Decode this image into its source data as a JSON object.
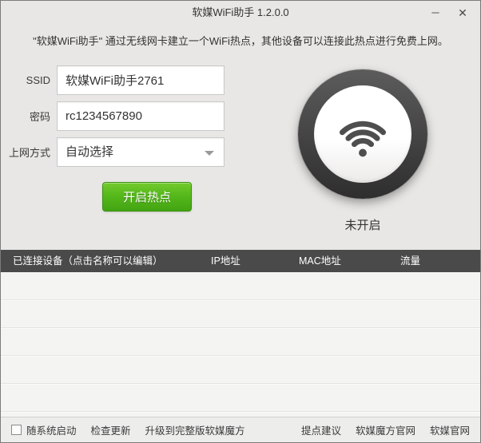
{
  "titlebar": {
    "title": "软媒WiFi助手 1.2.0.0",
    "minimize_glyph": "─",
    "close_glyph": "✕"
  },
  "intro": {
    "text": "\"软媒WiFi助手\" 通过无线网卡建立一个WiFi热点，其他设备可以连接此热点进行免费上网。"
  },
  "form": {
    "ssid_label": "SSID",
    "ssid_value": "软媒WiFi助手2761",
    "password_label": "密码",
    "password_value": "rc1234567890",
    "mode_label": "上网方式",
    "mode_value": "自动选择",
    "start_button_label": "开启热点"
  },
  "status": {
    "text": "未开启"
  },
  "table": {
    "headers": [
      "已连接设备（点击名称可以编辑）",
      "IP地址",
      "MAC地址",
      "流量"
    ],
    "rows": [],
    "empty_row_count": 5
  },
  "footer": {
    "autostart_label": "随系统启动",
    "autostart_checked": false,
    "check_update": "检查更新",
    "upgrade": "升级到完整版软媒魔方",
    "feedback": "提点建议",
    "mofang_site": "软媒魔方官网",
    "official_site": "软媒官网"
  },
  "colors": {
    "accent_green": "#4aae15",
    "table_header_bg": "#4a4a4a",
    "window_bg": "#e8e7e5",
    "wifi_glyph": "#4e4e4e"
  }
}
